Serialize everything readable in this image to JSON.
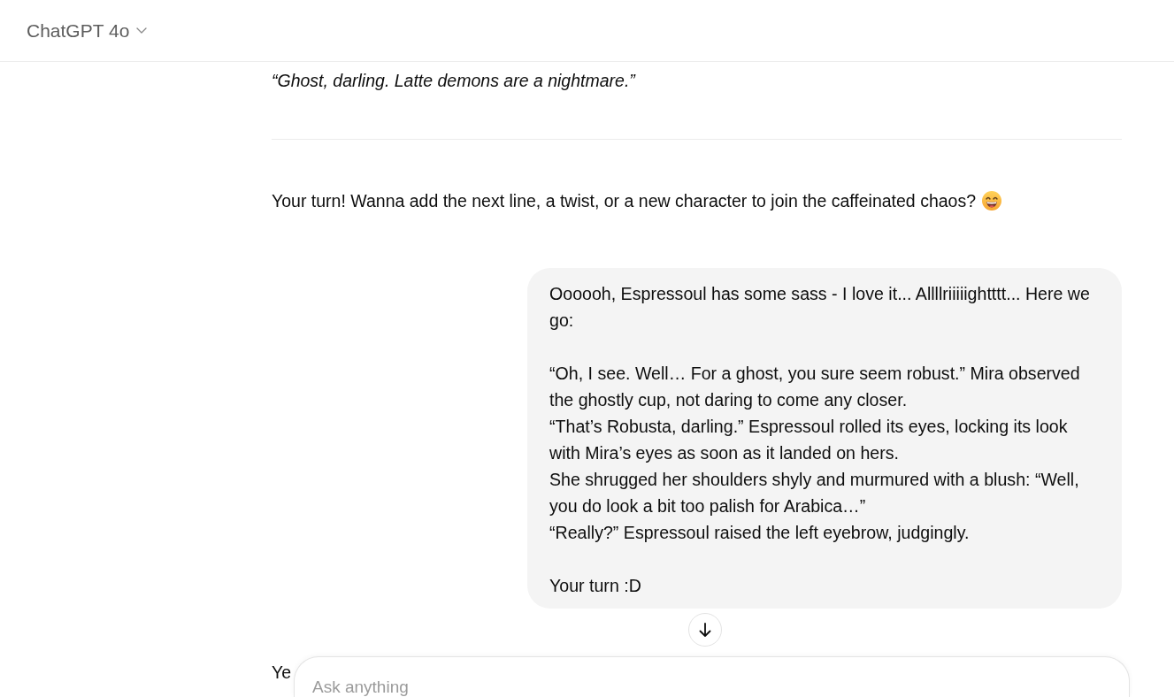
{
  "header": {
    "model_title": "ChatGPT 4o"
  },
  "conversation": [
    {
      "kind": "assistant_text",
      "italic": true,
      "emoji_after": false,
      "text": "“Ghost, darling. Latte demons are a nightmare.”"
    },
    {
      "kind": "divider"
    },
    {
      "kind": "assistant_text",
      "italic": false,
      "emoji_after": true,
      "text": "Your turn! Wanna add the next line, a twist, or a new character to join the caffeinated chaos?"
    },
    {
      "kind": "user_bubble",
      "paragraphs": [
        [
          "Oooooh, Espressoul has some sass - I love it... Allllriiiiightttt... Here we go:"
        ],
        [
          "“Oh, I see. Well… For a ghost, you sure seem robust.” Mira observed the ghostly cup, not daring to come any closer.",
          "“That’s Robusta, darling.” Espressoul rolled its eyes, locking its look with Mira’s eyes as soon as it landed on hers.",
          "She shrugged her shoulders shyly and murmured with a blush: “Well, you do look a bit too palish for Arabica…”",
          "“Really?” Espressoul raised the left eyebrow, judgingly."
        ],
        [
          "Your turn :D"
        ]
      ]
    },
    {
      "kind": "assistant_text",
      "italic": false,
      "emoji_after": false,
      "text": "Ye"
    }
  ],
  "composer": {
    "placeholder": "Ask anything"
  }
}
